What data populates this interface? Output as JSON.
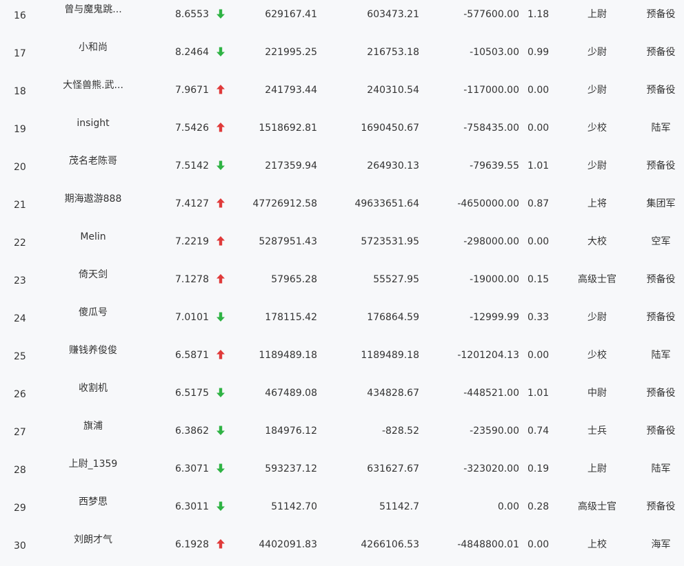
{
  "rows": [
    {
      "rank": "16",
      "name": "曾与魔鬼跳...",
      "score": "8.6553",
      "trend": "down",
      "v1": "629167.41",
      "v2": "603473.21",
      "v3": "-577600.00",
      "ratio": "1.18",
      "title": "上尉",
      "branch": "预备役"
    },
    {
      "rank": "17",
      "name": "小和尚",
      "score": "8.2464",
      "trend": "down",
      "v1": "221995.25",
      "v2": "216753.18",
      "v3": "-10503.00",
      "ratio": "0.99",
      "title": "少尉",
      "branch": "预备役"
    },
    {
      "rank": "18",
      "name": "大怪兽熊.武...",
      "score": "7.9671",
      "trend": "up",
      "v1": "241793.44",
      "v2": "240310.54",
      "v3": "-117000.00",
      "ratio": "0.00",
      "title": "少尉",
      "branch": "预备役"
    },
    {
      "rank": "19",
      "name": "insight",
      "score": "7.5426",
      "trend": "up",
      "v1": "1518692.81",
      "v2": "1690450.67",
      "v3": "-758435.00",
      "ratio": "0.00",
      "title": "少校",
      "branch": "陆军"
    },
    {
      "rank": "20",
      "name": "茂名老陈哥",
      "score": "7.5142",
      "trend": "down",
      "v1": "217359.94",
      "v2": "264930.13",
      "v3": "-79639.55",
      "ratio": "1.01",
      "title": "少尉",
      "branch": "预备役"
    },
    {
      "rank": "21",
      "name": "期海遨游888",
      "score": "7.4127",
      "trend": "up",
      "v1": "47726912.58",
      "v2": "49633651.64",
      "v3": "-4650000.00",
      "ratio": "0.87",
      "title": "上将",
      "branch": "集团军"
    },
    {
      "rank": "22",
      "name": "Melin",
      "score": "7.2219",
      "trend": "up",
      "v1": "5287951.43",
      "v2": "5723531.95",
      "v3": "-298000.00",
      "ratio": "0.00",
      "title": "大校",
      "branch": "空军"
    },
    {
      "rank": "23",
      "name": "倚天剑",
      "score": "7.1278",
      "trend": "up",
      "v1": "57965.28",
      "v2": "55527.95",
      "v3": "-19000.00",
      "ratio": "0.15",
      "title": "高级士官",
      "branch": "预备役"
    },
    {
      "rank": "24",
      "name": "傻瓜号",
      "score": "7.0101",
      "trend": "down",
      "v1": "178115.42",
      "v2": "176864.59",
      "v3": "-12999.99",
      "ratio": "0.33",
      "title": "少尉",
      "branch": "预备役"
    },
    {
      "rank": "25",
      "name": "赚钱养俊俊",
      "score": "6.5871",
      "trend": "up",
      "v1": "1189489.18",
      "v2": "1189489.18",
      "v3": "-1201204.13",
      "ratio": "0.00",
      "title": "少校",
      "branch": "陆军"
    },
    {
      "rank": "26",
      "name": "收割机",
      "score": "6.5175",
      "trend": "down",
      "v1": "467489.08",
      "v2": "434828.67",
      "v3": "-448521.00",
      "ratio": "1.01",
      "title": "中尉",
      "branch": "预备役"
    },
    {
      "rank": "27",
      "name": "旗浦",
      "score": "6.3862",
      "trend": "down",
      "v1": "184976.12",
      "v2": "-828.52",
      "v3": "-23590.00",
      "ratio": "0.74",
      "title": "士兵",
      "branch": "预备役"
    },
    {
      "rank": "28",
      "name": "上尉_1359",
      "score": "6.3071",
      "trend": "down",
      "v1": "593237.12",
      "v2": "631627.67",
      "v3": "-323020.00",
      "ratio": "0.19",
      "title": "上尉",
      "branch": "陆军"
    },
    {
      "rank": "29",
      "name": "西梦思",
      "score": "6.3011",
      "trend": "down",
      "v1": "51142.70",
      "v2": "51142.7",
      "v3": "0.00",
      "ratio": "0.28",
      "title": "高级士官",
      "branch": "预备役"
    },
    {
      "rank": "30",
      "name": "刘朗才气",
      "score": "6.1928",
      "trend": "up",
      "v1": "4402091.83",
      "v2": "4266106.53",
      "v3": "-4848800.01",
      "ratio": "0.00",
      "title": "上校",
      "branch": "海军"
    }
  ],
  "colors": {
    "up": "#e03a3a",
    "down": "#2fb344",
    "text": "#333333",
    "background": "#f7f8fa"
  },
  "icons": {
    "up": "arrow-up-icon",
    "down": "arrow-down-icon"
  }
}
